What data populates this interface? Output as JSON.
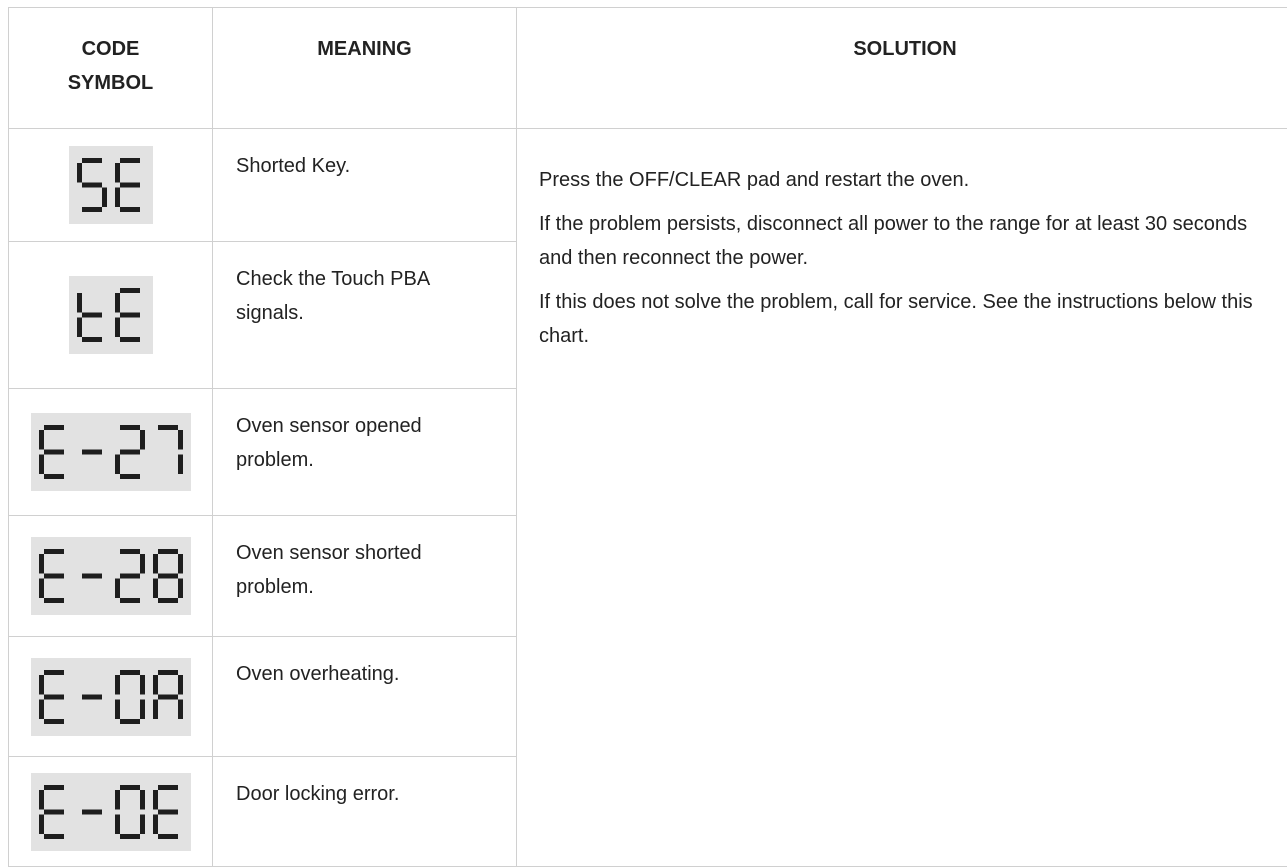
{
  "headers": {
    "code": "CODE SYMBOL",
    "meaning": "MEANING",
    "solution": "SOLUTION"
  },
  "rows": [
    {
      "code": "SE",
      "meaning": "Shorted Key."
    },
    {
      "code": "tE",
      "meaning": "Check the Touch PBA signals."
    },
    {
      "code": "E-27",
      "meaning": "Oven sensor opened problem."
    },
    {
      "code": "E-28",
      "meaning": "Oven sensor shorted problem."
    },
    {
      "code": "E-0A",
      "meaning": "Oven overheating."
    },
    {
      "code": "E-0E",
      "meaning": "Door locking error."
    }
  ],
  "solution": {
    "p1": "Press the OFF/CLEAR pad and restart the oven.",
    "p2": "If the problem persists, disconnect all power to the range for at least 30 seconds and then reconnect the power.",
    "p3": "If this does not solve the problem, call for service. See the instructions below this chart."
  },
  "colors": {
    "lcd_background": "#e2e2e2",
    "lcd_segment": "#1e1e1e",
    "border": "#d0d0d0",
    "text": "#222222"
  }
}
